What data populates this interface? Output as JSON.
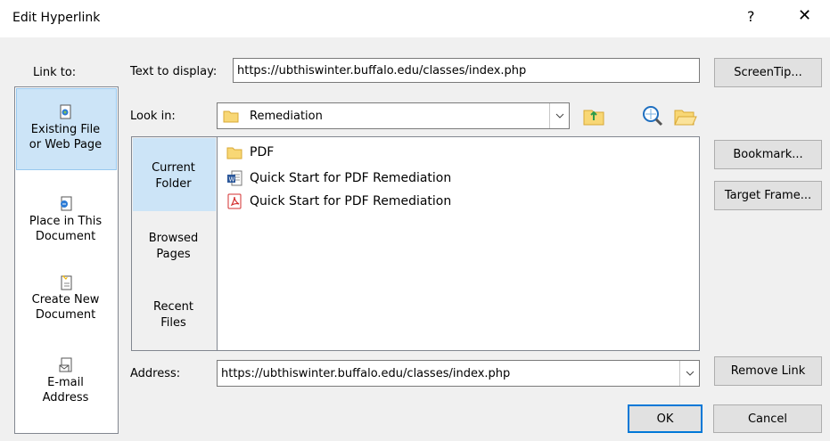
{
  "window": {
    "title": "Edit Hyperlink",
    "help_glyph": "?",
    "close_glyph": "✕"
  },
  "link_to": {
    "heading": "Link to:",
    "items": [
      {
        "line1": "Existing File",
        "line2": "or Web Page",
        "icon": "existing-file-icon"
      },
      {
        "line1": "Place in This",
        "line2": "Document",
        "icon": "place-in-document-icon"
      },
      {
        "line1": "Create New",
        "line2": "Document",
        "icon": "create-new-document-icon"
      },
      {
        "line1": "E-mail",
        "line2": "Address",
        "icon": "email-address-icon"
      }
    ]
  },
  "text_to_display": {
    "label": "Text to display:",
    "value": "https://ubthiswinter.buffalo.edu/classes/index.php"
  },
  "screentip_button": "ScreenTip...",
  "look_in": {
    "label": "Look in:",
    "value": "Remediation"
  },
  "side_tabs": [
    {
      "line1": "Current",
      "line2": "Folder"
    },
    {
      "line1": "Browsed",
      "line2": "Pages"
    },
    {
      "line1": "Recent",
      "line2": "Files"
    }
  ],
  "files": [
    {
      "name": "PDF",
      "icon": "folder-icon"
    },
    {
      "name": "Quick Start for PDF Remediation",
      "icon": "word-doc-icon"
    },
    {
      "name": "Quick Start for PDF Remediation",
      "icon": "pdf-icon"
    }
  ],
  "bookmark_button": "Bookmark...",
  "target_frame_button": "Target Frame...",
  "address": {
    "label": "Address:",
    "value": "https://ubthiswinter.buffalo.edu/classes/index.php"
  },
  "remove_link_button": "Remove Link",
  "ok_button": "OK",
  "cancel_button": "Cancel"
}
